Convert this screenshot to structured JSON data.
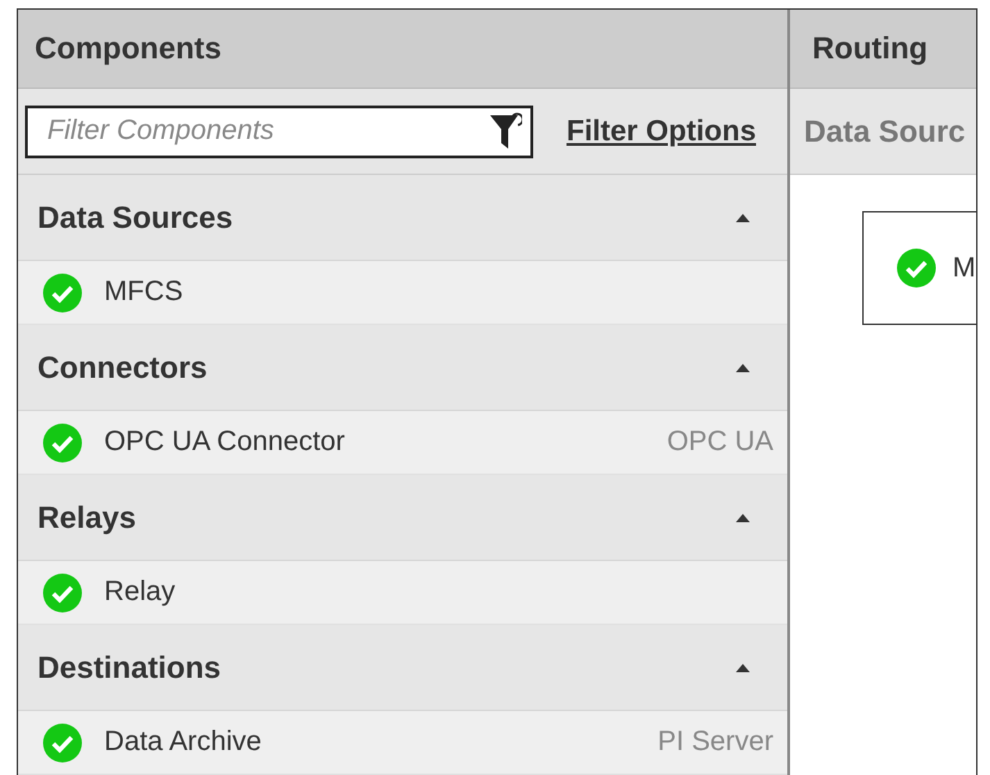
{
  "components_panel": {
    "title": "Components",
    "filter": {
      "placeholder": "Filter Components"
    },
    "filter_options_link": "Filter Options",
    "sections": [
      {
        "title": "Data Sources",
        "expanded": true,
        "items": [
          {
            "name": "MFCS"
          }
        ]
      },
      {
        "title": "Connectors",
        "expanded": true,
        "items": [
          {
            "name": "OPC UA Connector",
            "type": "OPC UA"
          }
        ]
      },
      {
        "title": "Relays",
        "expanded": true,
        "items": [
          {
            "name": "Relay"
          }
        ]
      },
      {
        "title": "Destinations",
        "expanded": true,
        "items": [
          {
            "name": "Data Archive",
            "type": "PI Server"
          }
        ]
      }
    ]
  },
  "routing_panel": {
    "title": "Routing",
    "column_title": "Data Sourc",
    "nodes": [
      {
        "name": "M"
      }
    ]
  }
}
